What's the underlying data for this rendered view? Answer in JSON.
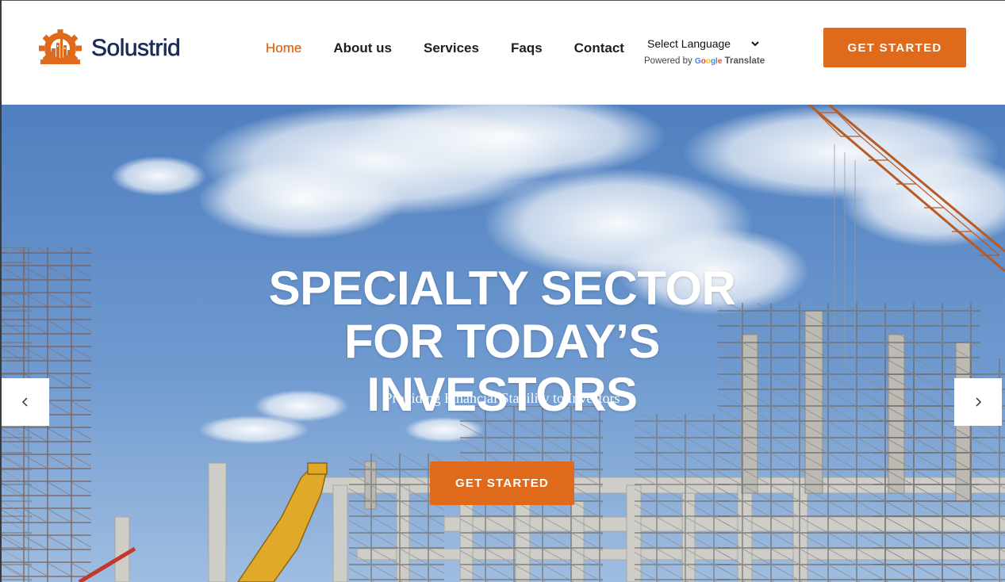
{
  "brand": {
    "name": "Solustrid",
    "accent_color": "#e06a1b",
    "text_color": "#1b2a59"
  },
  "nav": {
    "items": [
      {
        "label": "Home",
        "active": true
      },
      {
        "label": "About us",
        "active": false
      },
      {
        "label": "Services",
        "active": false
      },
      {
        "label": "Faqs",
        "active": false
      },
      {
        "label": "Contact",
        "active": false
      }
    ]
  },
  "language": {
    "select_label": "Select Language",
    "powered_by": "Powered by",
    "google": "Google",
    "translate": "Translate"
  },
  "header": {
    "cta_label": "GET STARTED"
  },
  "hero": {
    "title": "SPECIALTY SECTOR FOR TODAY’S INVESTORS",
    "subtitle": "Providing Financial Stability to Investors",
    "cta_label": "GET STARTED",
    "prev_icon": "chevron-left-icon",
    "next_icon": "chevron-right-icon"
  }
}
